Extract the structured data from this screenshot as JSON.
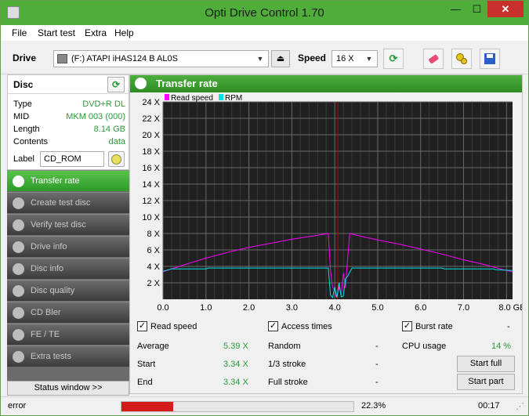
{
  "window": {
    "title": "Opti Drive Control 1.70",
    "minimize_glyph": "—",
    "maximize_glyph": "☐",
    "close_glyph": "✕"
  },
  "menu": [
    "File",
    "Start test",
    "Extra",
    "Help"
  ],
  "toolbar": {
    "drive_label": "Drive",
    "drive_value": "(F:)  ATAPI iHAS124   B AL0S",
    "speed_label": "Speed",
    "speed_value": "16 X",
    "eject_glyph": "⏏",
    "icons": [
      "refresh-icon",
      "erase-icon",
      "settings-icon",
      "save-icon"
    ]
  },
  "disc": {
    "heading": "Disc",
    "refresh_glyph": "⟳",
    "rows": [
      {
        "key": "Type",
        "value": "DVD+R DL"
      },
      {
        "key": "MID",
        "value": "MKM 003 (000)"
      },
      {
        "key": "Length",
        "value": "8.14 GB"
      },
      {
        "key": "Contents",
        "value": "data"
      }
    ],
    "label_key": "Label",
    "label_value": "CD_ROM"
  },
  "nav": [
    {
      "label": "Transfer rate",
      "active": true
    },
    {
      "label": "Create test disc"
    },
    {
      "label": "Verify test disc"
    },
    {
      "label": "Drive info"
    },
    {
      "label": "Disc info"
    },
    {
      "label": "Disc quality"
    },
    {
      "label": "CD Bler"
    },
    {
      "label": "FE / TE"
    },
    {
      "label": "Extra tests"
    }
  ],
  "status_window_button": "Status window >>",
  "panel_title": "Transfer rate",
  "chart_data": {
    "type": "line",
    "legend": [
      "Read speed",
      "RPM"
    ],
    "colors": {
      "read": "#ff00ff",
      "rpm": "#00e5e5",
      "marker": "#c00000",
      "grid": "#6a6a6a",
      "bg": "#202020"
    },
    "xlim": [
      0,
      8.14
    ],
    "ylim": [
      0,
      24
    ],
    "xticks": [
      "0.0",
      "1.0",
      "2.0",
      "3.0",
      "4.0",
      "5.0",
      "6.0",
      "7.0",
      "8.0 GB"
    ],
    "yticks": [
      "2 X",
      "4 X",
      "6 X",
      "8 X",
      "10 X",
      "12 X",
      "14 X",
      "16 X",
      "18 X",
      "20 X",
      "22 X",
      "24 X"
    ],
    "layer_break_x": 4.07,
    "series": [
      {
        "name": "Read speed",
        "x": [
          0.0,
          0.5,
          1.0,
          1.5,
          2.0,
          2.5,
          3.0,
          3.5,
          3.85,
          3.9,
          3.95,
          4.0,
          4.02,
          4.05,
          4.1,
          4.15,
          4.2,
          4.25,
          4.3,
          4.35,
          4.5,
          5.0,
          5.5,
          6.0,
          6.5,
          7.0,
          7.5,
          8.0,
          8.14
        ],
        "y": [
          3.34,
          4.2,
          5.0,
          5.7,
          6.3,
          6.8,
          7.3,
          7.7,
          8.0,
          3.5,
          1.5,
          1.0,
          0.4,
          0.3,
          1.5,
          0.5,
          3.2,
          1.4,
          5.0,
          8.0,
          7.8,
          7.2,
          6.7,
          6.1,
          5.5,
          4.8,
          4.2,
          3.5,
          3.34
        ]
      },
      {
        "name": "RPM",
        "x": [
          0.0,
          0.2,
          1.0,
          1.05,
          3.85,
          3.9,
          3.95,
          4.0,
          4.05,
          4.1,
          4.15,
          4.2,
          4.25,
          4.3,
          4.4,
          6.5,
          6.55,
          7.7,
          7.75,
          8.14
        ],
        "y": [
          3.4,
          3.7,
          3.7,
          3.8,
          3.8,
          0.5,
          0.2,
          1.5,
          0.2,
          2.0,
          0.3,
          0.4,
          2.5,
          2.8,
          3.8,
          3.8,
          3.7,
          3.7,
          3.6,
          3.5
        ]
      }
    ]
  },
  "stats": {
    "read_speed_label": "Read speed",
    "access_times_label": "Access times",
    "burst_rate_label": "Burst rate",
    "burst_rate_value": "-",
    "average_label": "Average",
    "average_value": "5.39 X",
    "start_label": "Start",
    "start_value": "3.34 X",
    "end_label": "End",
    "end_value": "3.34 X",
    "random_label": "Random",
    "random_value": "-",
    "third_label": "1/3 stroke",
    "third_value": "-",
    "full_label": "Full stroke",
    "full_value": "-",
    "cpu_label": "CPU usage",
    "cpu_value": "14 %",
    "start_full_button": "Start full",
    "start_part_button": "Start part",
    "checkmark": "✓"
  },
  "statusbar": {
    "message": "error",
    "progress_percent": 22.3,
    "progress_text": "22.3%",
    "time": "00:17"
  }
}
